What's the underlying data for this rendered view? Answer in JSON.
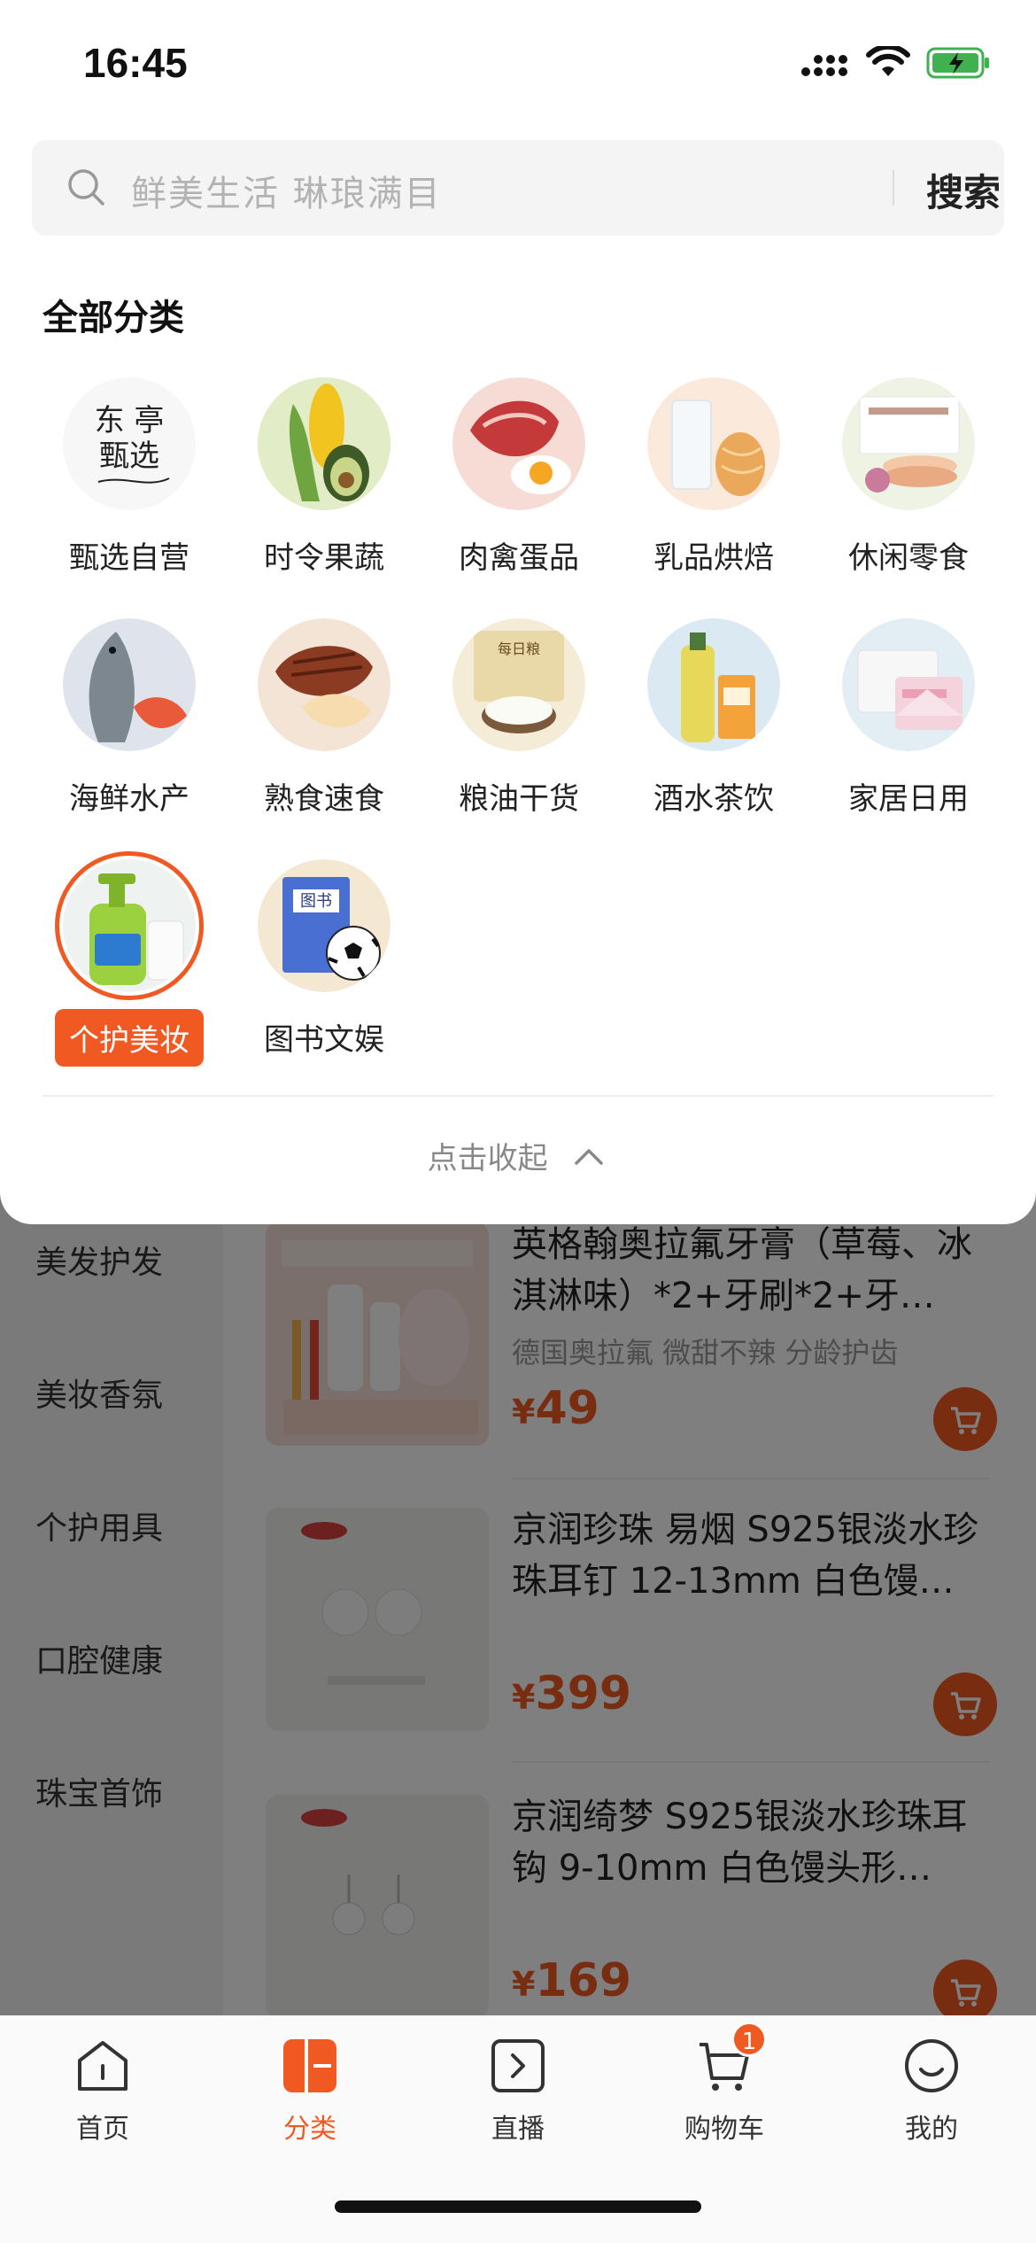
{
  "status_bar": {
    "time": "16:45"
  },
  "search": {
    "placeholder": "鲜美生活 琳琅满目",
    "button_label": "搜索"
  },
  "section_title": "全部分类",
  "categories": [
    {
      "label": "甄选自营",
      "icon": "brand-logo-icon"
    },
    {
      "label": "时令果蔬",
      "icon": "corn-avocado-icon"
    },
    {
      "label": "肉禽蛋品",
      "icon": "meat-egg-icon"
    },
    {
      "label": "乳品烘焙",
      "icon": "milk-bread-icon"
    },
    {
      "label": "休闲零食",
      "icon": "snack-box-icon"
    },
    {
      "label": "海鲜水产",
      "icon": "fish-shrimp-icon"
    },
    {
      "label": "熟食速食",
      "icon": "steak-dumpling-icon"
    },
    {
      "label": "粮油干货",
      "icon": "rice-bag-icon"
    },
    {
      "label": "酒水茶饮",
      "icon": "drinks-icon"
    },
    {
      "label": "家居日用",
      "icon": "tissue-icon"
    },
    {
      "label": "个护美妆",
      "icon": "shampoo-bottle-icon",
      "selected": true
    },
    {
      "label": "图书文娱",
      "icon": "book-football-icon"
    }
  ],
  "collapse_label": "点击收起",
  "left_nav": [
    "美发护发",
    "美妆香氛",
    "个护用具",
    "口腔健康",
    "珠宝首饰"
  ],
  "products": [
    {
      "title": "英格翰奥拉氟牙膏（草莓、冰淇淋味）*2+牙刷*2+牙…",
      "subtitle": "德国奥拉氟 微甜不辣 分龄护齿",
      "price_symbol": "¥",
      "price": "49"
    },
    {
      "title": "京润珍珠 易烟 S925银淡水珍珠耳钉 12-13mm 白色馒…",
      "subtitle": "",
      "price_symbol": "¥",
      "price": "399"
    },
    {
      "title": "京润绮梦 S925银淡水珍珠耳钩 9-10mm 白色馒头形…",
      "subtitle": "",
      "price_symbol": "¥",
      "price": "169"
    }
  ],
  "tabbar": [
    {
      "label": "首页",
      "icon": "home-icon"
    },
    {
      "label": "分类",
      "icon": "category-icon",
      "active": true
    },
    {
      "label": "直播",
      "icon": "live-play-icon"
    },
    {
      "label": "购物车",
      "icon": "cart-icon",
      "badge": "1"
    },
    {
      "label": "我的",
      "icon": "profile-smile-icon"
    }
  ],
  "colors": {
    "accent": "#f05a22",
    "overlay": "rgba(0,0,0,0.5)"
  }
}
